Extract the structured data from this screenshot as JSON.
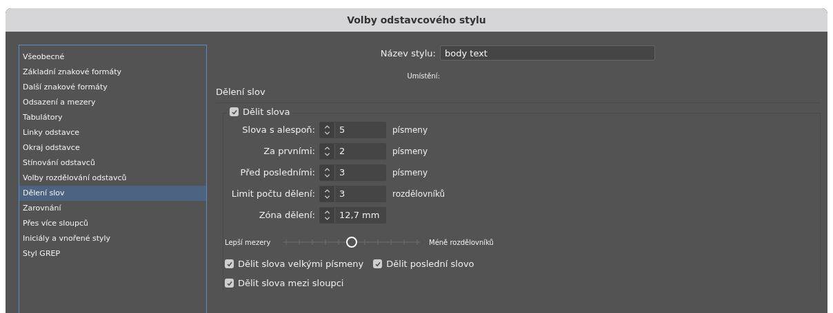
{
  "window": {
    "title": "Volby odstavcového stylu"
  },
  "sidebar": {
    "items": [
      {
        "label": "Všeobecné",
        "selected": false
      },
      {
        "label": "Základní znakové formáty",
        "selected": false
      },
      {
        "label": "Další znakové formáty",
        "selected": false
      },
      {
        "label": "Odsazení a mezery",
        "selected": false
      },
      {
        "label": "Tabulátory",
        "selected": false
      },
      {
        "label": "Linky odstavce",
        "selected": false
      },
      {
        "label": "Okraj odstavce",
        "selected": false
      },
      {
        "label": "Stínování odstavců",
        "selected": false
      },
      {
        "label": "Volby rozdělování odstavců",
        "selected": false
      },
      {
        "label": "Dělení slov",
        "selected": true
      },
      {
        "label": "Zarovnání",
        "selected": false
      },
      {
        "label": "Přes více sloupců",
        "selected": false
      },
      {
        "label": "Iniciály a vnořené styly",
        "selected": false
      },
      {
        "label": "Styl GREP",
        "selected": false
      }
    ]
  },
  "style_name": {
    "label": "Název stylu:",
    "value": "body text"
  },
  "location": {
    "label": "Umístění:"
  },
  "section_title": "Dělení slov",
  "hyphenate": {
    "label": "Dělit slova",
    "checked": true
  },
  "fields": [
    {
      "label": "Slova s alespoň:",
      "value": "5",
      "unit": "písmeny"
    },
    {
      "label": "Za prvními:",
      "value": "2",
      "unit": "písmeny"
    },
    {
      "label": "Před posledními:",
      "value": "3",
      "unit": "písmeny"
    },
    {
      "label": "Limit počtu dělení:",
      "value": "3",
      "unit": "rozdělovníků"
    },
    {
      "label": "Zóna dělení:",
      "value": "12,7 mm"
    }
  ],
  "slider": {
    "left_label": "Lepší mezery",
    "right_label": "Méně rozdělovníků",
    "level": 0.5
  },
  "options": [
    [
      {
        "label": "Dělit slova velkými písmeny",
        "checked": true
      },
      {
        "label": "Dělit poslední slovo",
        "checked": true
      }
    ],
    [
      {
        "label": "Dělit slova mezi sloupci",
        "checked": true
      }
    ]
  ]
}
